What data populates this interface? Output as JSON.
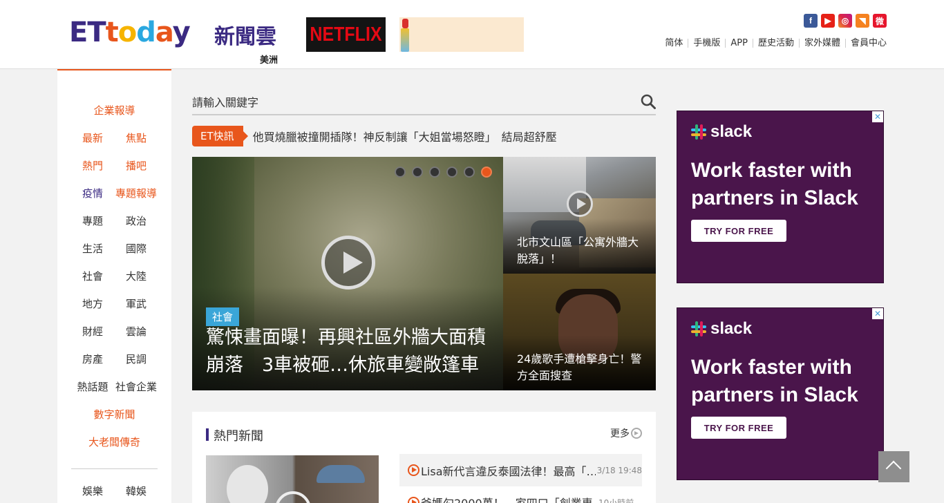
{
  "header": {
    "logo": {
      "brand_parts": [
        "E",
        "T",
        "t",
        "o",
        "d",
        "a",
        "y"
      ],
      "cn": "新聞雲",
      "region": "美洲"
    },
    "ad1": {
      "text": "NETFLIX"
    },
    "social": [
      {
        "name": "facebook-icon",
        "glyph": "f"
      },
      {
        "name": "youtube-icon",
        "glyph": "▶"
      },
      {
        "name": "instagram-icon",
        "glyph": "◎"
      },
      {
        "name": "rss-icon",
        "glyph": "◥"
      },
      {
        "name": "weibo-icon",
        "glyph": "微"
      }
    ],
    "links": [
      "简体",
      "手機版",
      "APP",
      "歷史活動",
      "家外媒體",
      "會員中心"
    ]
  },
  "leftnav": {
    "rows": [
      [
        "企業報導"
      ],
      [
        "最新",
        "焦點"
      ],
      [
        "熱門",
        "播吧"
      ],
      [
        "疫情",
        "專題報導"
      ],
      [
        "專題",
        "政治"
      ],
      [
        "生活",
        "國際"
      ],
      [
        "社會",
        "大陸"
      ],
      [
        "地方",
        "軍武"
      ],
      [
        "財經",
        "雲論"
      ],
      [
        "房產",
        "民調"
      ],
      [
        "熱話題",
        "社會企業"
      ],
      [
        "數字新聞"
      ],
      [
        "大老闆傳奇"
      ],
      [
        "娛樂",
        "韓娛"
      ]
    ]
  },
  "search": {
    "placeholder": "請輸入關鍵字"
  },
  "flash": {
    "tag": "ET快訊",
    "text": "他買燒臘被撞開插隊！神反制讓「大姐當場怒瞪」　結局超舒壓"
  },
  "hero": {
    "category": "社會",
    "title": "驚悚畫面曝！再興社區外牆大面積崩落　3車被砸…休旅車變敞篷車",
    "slides": 6,
    "active_slide": 6
  },
  "side_stories": [
    {
      "title": "北市文山區「公寓外牆大脫落」！"
    },
    {
      "title": "24歲歌手遭槍擊身亡！警方全面搜查"
    }
  ],
  "hot_news": {
    "heading": "熱門新聞",
    "more": "更多",
    "items": [
      {
        "text": "Lisa新代言違反泰國法律！最高「…",
        "time": "3/18 19:48"
      },
      {
        "text": "爸媽勾2000萬！　家四口「創業專…",
        "time": "10小時前"
      }
    ]
  },
  "right_ads": [
    {
      "brand": "slack",
      "headline": "Work faster with partners in Slack",
      "cta": "TRY FOR FREE",
      "close": "✕"
    },
    {
      "brand": "slack",
      "headline": "Work faster with partners in Slack",
      "cta": "TRY FOR FREE",
      "close": "✕"
    }
  ],
  "colors": {
    "accent": "#e8561c",
    "brand_purple": "#3b2a82",
    "slack_bg": "#4a154b"
  }
}
